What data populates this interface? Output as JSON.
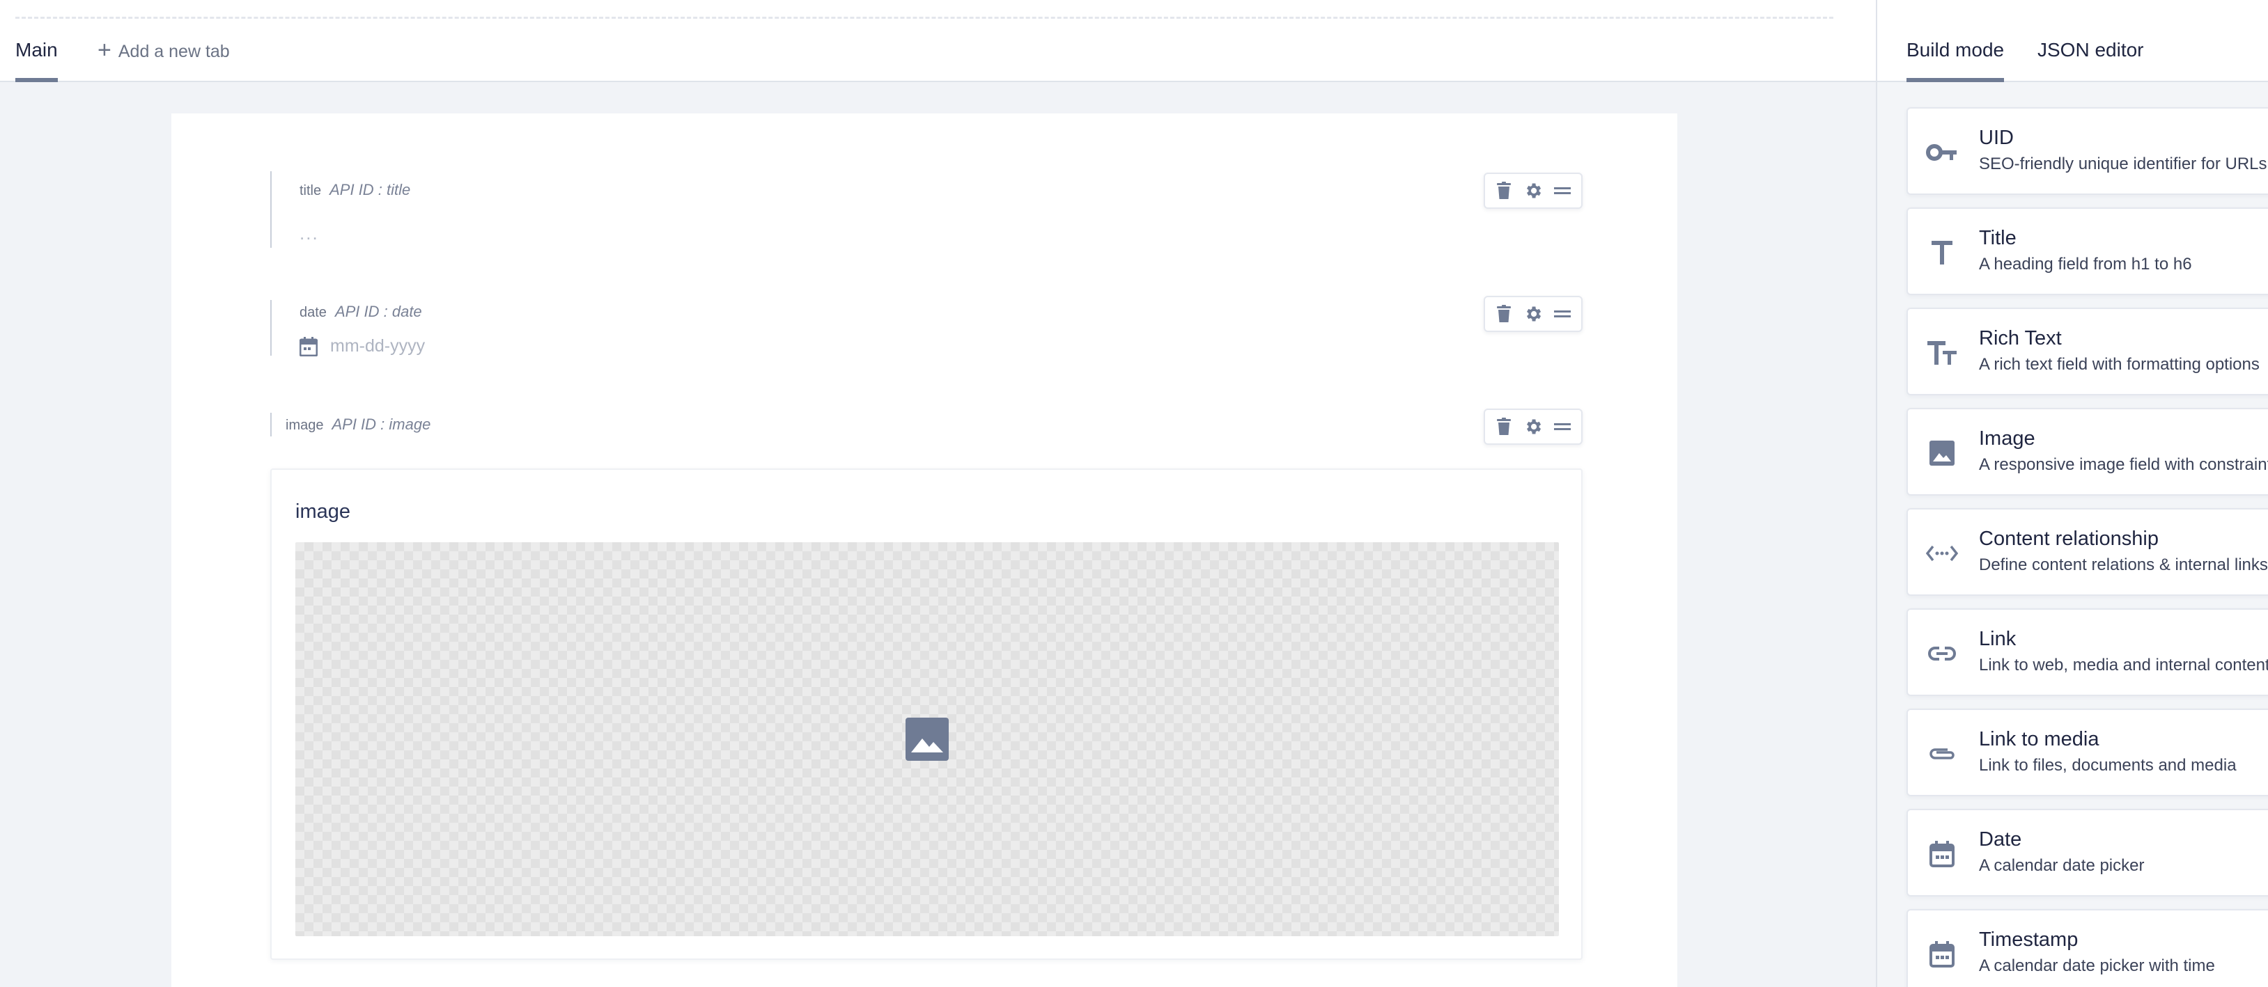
{
  "tabs": {
    "main_label": "Main",
    "add_tab_label": "Add a new tab"
  },
  "fields": [
    {
      "key": "title",
      "api_id": "API ID : title",
      "placeholder": "..."
    },
    {
      "key": "date",
      "api_id": "API ID : date",
      "placeholder": "mm-dd-yyyy"
    },
    {
      "key": "image",
      "api_id": "API ID : image"
    }
  ],
  "image_preview": {
    "title": "image"
  },
  "right_panel": {
    "tabs": [
      "Build mode",
      "JSON editor"
    ],
    "active_tab": "Build mode",
    "widgets": [
      {
        "name": "UID",
        "description": "SEO-friendly unique identifier for URLs",
        "icon": "key-icon"
      },
      {
        "name": "Title",
        "description": "A heading field from h1 to h6",
        "icon": "title-icon"
      },
      {
        "name": "Rich Text",
        "description": "A rich text field with formatting options",
        "icon": "rich-text-icon"
      },
      {
        "name": "Image",
        "description": "A responsive image field with constraints",
        "icon": "image-icon"
      },
      {
        "name": "Content relationship",
        "description": "Define content relations & internal links",
        "icon": "relationship-icon"
      },
      {
        "name": "Link",
        "description": "Link to web, media and internal content",
        "icon": "link-icon"
      },
      {
        "name": "Link to media",
        "description": "Link to files, documents and media",
        "icon": "attachment-icon"
      },
      {
        "name": "Date",
        "description": "A calendar date picker",
        "icon": "calendar-icon"
      },
      {
        "name": "Timestamp",
        "description": "A calendar date picker with time",
        "icon": "calendar-icon"
      }
    ]
  },
  "colors": {
    "accent": "#6f7b94",
    "text": "#1f2540",
    "muted": "#6b7385",
    "background": "#f1f3f7"
  }
}
